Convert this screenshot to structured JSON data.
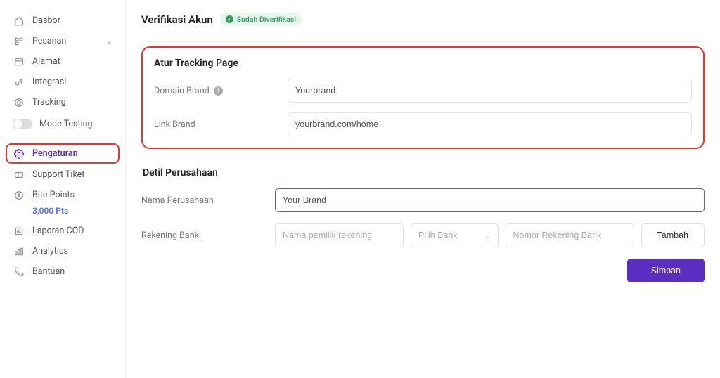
{
  "sidebar": {
    "items": [
      {
        "label": "Dasbor"
      },
      {
        "label": "Pesanan"
      },
      {
        "label": "Alamat"
      },
      {
        "label": "Integrasi"
      },
      {
        "label": "Tracking"
      }
    ],
    "mode_testing": "Mode Testing",
    "pengaturan": "Pengaturan",
    "support_tiket": "Support Tiket",
    "bite_points": "Bite Points",
    "bite_points_value": "3,000 Pts",
    "laporan_cod": "Laporan COD",
    "analytics": "Analytics",
    "bantuan": "Bantuan"
  },
  "header": {
    "title": "Verifikasi Akun",
    "badge": "Sudah Diverifikasi"
  },
  "tracking": {
    "title": "Atur Tracking Page",
    "domain_label": "Domain Brand",
    "domain_value": "Yourbrand",
    "link_label": "Link Brand",
    "link_value": "yourbrand.com/home"
  },
  "company": {
    "title": "Detil Perusahaan",
    "name_label": "Nama Perusahaan",
    "name_value": "Your Brand",
    "bank_label": "Rekening Bank",
    "owner_placeholder": "Nama pemilik rekening",
    "select_placeholder": "Pilih Bank",
    "number_placeholder": "Nomor Rekening Bank",
    "add_button": "Tambah",
    "save_button": "Simpan"
  }
}
